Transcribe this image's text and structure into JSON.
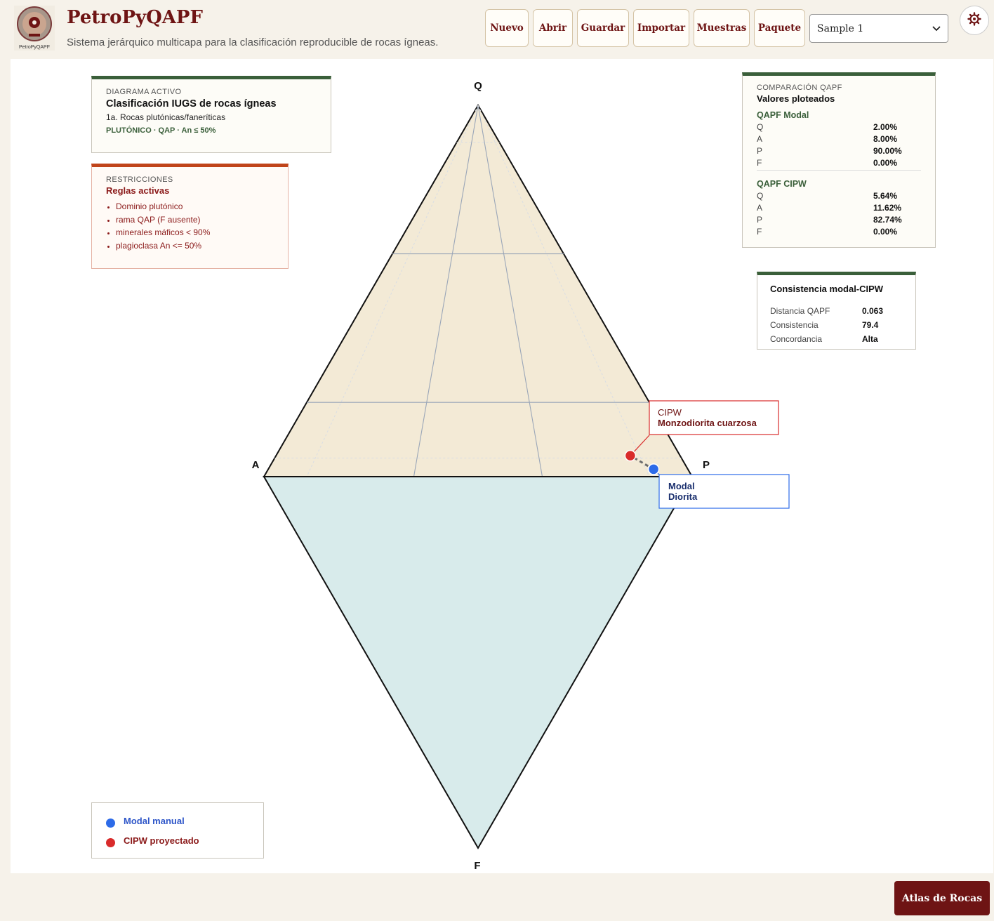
{
  "app": {
    "title": "PetroPyQAPF",
    "subtitle": "Sistema jerárquico multicapa para la clasificación reproducible de rocas ígneas.",
    "logo_text": "PetroPyQAPF"
  },
  "toolbar": {
    "buttons": [
      "Nuevo",
      "Abrir",
      "Guardar",
      "Importar",
      "Muestras",
      "Paquete"
    ],
    "sample_selected": "Sample 1"
  },
  "active_diagram": {
    "kicker": "DIAGRAMA ACTIVO",
    "title": "Clasificación IUGS de rocas ígneas",
    "subtitle": "1a. Rocas plutónicas/faneríticas",
    "tag": "PLUTÓNICO · QAP · An ≤ 50%",
    "accent": "#3a5f3a"
  },
  "restrictions": {
    "kicker": "RESTRICCIONES",
    "title": "Reglas activas",
    "rules": [
      "Dominio plutónico",
      "rama QAP (F ausente)",
      "minerales máficos < 90%",
      "plagioclasa An <= 50%"
    ],
    "accent": "#c0441a"
  },
  "comparison": {
    "kicker": "COMPARACIÓN QAPF",
    "title": "Valores ploteados",
    "modal": {
      "heading": "QAPF Modal",
      "rows": [
        [
          "Q",
          "2.00%"
        ],
        [
          "A",
          "8.00%"
        ],
        [
          "P",
          "90.00%"
        ],
        [
          "F",
          "0.00%"
        ]
      ]
    },
    "cipw": {
      "heading": "QAPF CIPW",
      "rows": [
        [
          "Q",
          "5.64%"
        ],
        [
          "A",
          "11.62%"
        ],
        [
          "P",
          "82.74%"
        ],
        [
          "F",
          "0.00%"
        ]
      ]
    }
  },
  "consistency": {
    "title": "Consistencia modal-CIPW",
    "rows": [
      [
        "Distancia QAPF",
        "0.063"
      ],
      [
        "Consistencia",
        "79.4"
      ],
      [
        "Concordancia",
        "Alta"
      ]
    ]
  },
  "chart_data": {
    "type": "scatter",
    "diagram": "QAPF",
    "vertices": [
      "Q",
      "A",
      "P",
      "F"
    ],
    "points": [
      {
        "label": "Modal",
        "rock": "Diorita",
        "Q": 2.0,
        "A": 8.0,
        "P": 90.0,
        "F": 0.0,
        "color": "#2d6be8"
      },
      {
        "label": "CIPW",
        "rock": "Monzodiorita cuarzosa",
        "Q": 5.64,
        "A": 11.62,
        "P": 82.74,
        "F": 0.0,
        "color": "#d92b2b"
      }
    ],
    "upper_fill": "#f3ead6",
    "lower_fill": "#d8ebeb"
  },
  "legend": [
    {
      "label": "Modal manual",
      "color": "#2d6be8"
    },
    {
      "label": "CIPW proyectado",
      "color": "#d92b2b"
    }
  ],
  "atlas_button": "Atlas de Rocas"
}
